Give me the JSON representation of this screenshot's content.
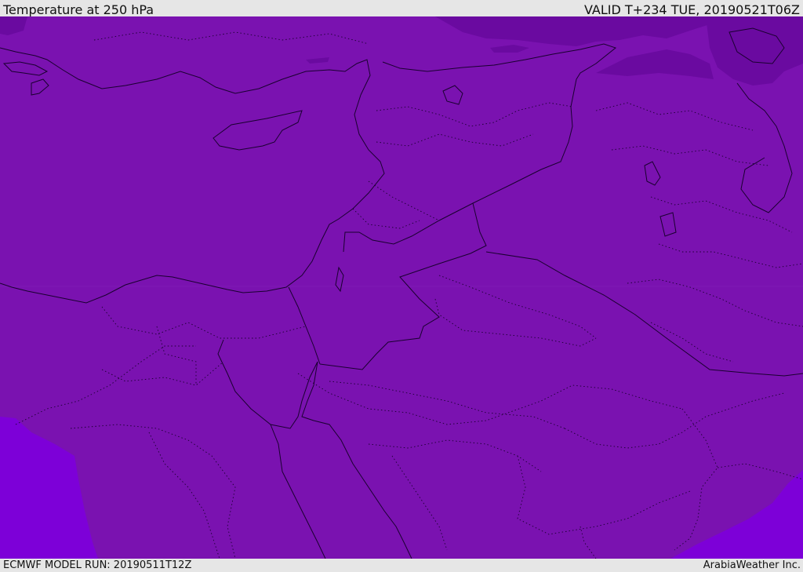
{
  "header": {
    "title": "Temperature at 250 hPa",
    "valid_time": "VALID T+234 TUE, 20190521T06Z"
  },
  "footer": {
    "model_run": "ECMWF MODEL RUN: 20190511T12Z",
    "credit": "ArabiaWeather Inc."
  },
  "map": {
    "region": "Eastern Mediterranean and Middle East",
    "colors": {
      "field_main": "#7a12b0",
      "field_cooler": "#6a0aa0",
      "field_warmer": "#7d00d8",
      "coastline": "#1a0030",
      "border": "#1a0030",
      "background": "#e6e6e6"
    }
  }
}
